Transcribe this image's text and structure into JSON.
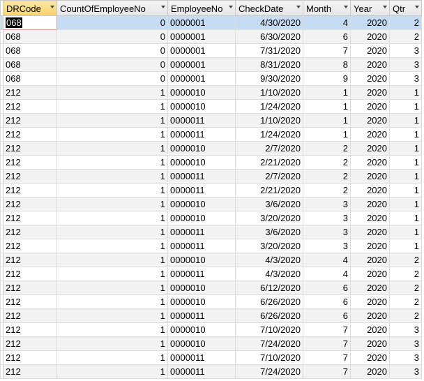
{
  "columns": [
    {
      "label": "DRCode",
      "align": "left"
    },
    {
      "label": "CountOfEmployeeNo",
      "align": "right"
    },
    {
      "label": "EmployeeNo",
      "align": "left"
    },
    {
      "label": "CheckDate",
      "align": "right"
    },
    {
      "label": "Month",
      "align": "right"
    },
    {
      "label": "Year",
      "align": "right"
    },
    {
      "label": "Qtr",
      "align": "right"
    }
  ],
  "rows": [
    [
      "068",
      "0",
      "0000001",
      "4/30/2020",
      "4",
      "2020",
      "2"
    ],
    [
      "068",
      "0",
      "0000001",
      "6/30/2020",
      "6",
      "2020",
      "2"
    ],
    [
      "068",
      "0",
      "0000001",
      "7/31/2020",
      "7",
      "2020",
      "3"
    ],
    [
      "068",
      "0",
      "0000001",
      "8/31/2020",
      "8",
      "2020",
      "3"
    ],
    [
      "068",
      "0",
      "0000001",
      "9/30/2020",
      "9",
      "2020",
      "3"
    ],
    [
      "212",
      "1",
      "0000010",
      "1/10/2020",
      "1",
      "2020",
      "1"
    ],
    [
      "212",
      "1",
      "0000010",
      "1/24/2020",
      "1",
      "2020",
      "1"
    ],
    [
      "212",
      "1",
      "0000011",
      "1/10/2020",
      "1",
      "2020",
      "1"
    ],
    [
      "212",
      "1",
      "0000011",
      "1/24/2020",
      "1",
      "2020",
      "1"
    ],
    [
      "212",
      "1",
      "0000010",
      "2/7/2020",
      "2",
      "2020",
      "1"
    ],
    [
      "212",
      "1",
      "0000010",
      "2/21/2020",
      "2",
      "2020",
      "1"
    ],
    [
      "212",
      "1",
      "0000011",
      "2/7/2020",
      "2",
      "2020",
      "1"
    ],
    [
      "212",
      "1",
      "0000011",
      "2/21/2020",
      "2",
      "2020",
      "1"
    ],
    [
      "212",
      "1",
      "0000010",
      "3/6/2020",
      "3",
      "2020",
      "1"
    ],
    [
      "212",
      "1",
      "0000010",
      "3/20/2020",
      "3",
      "2020",
      "1"
    ],
    [
      "212",
      "1",
      "0000011",
      "3/6/2020",
      "3",
      "2020",
      "1"
    ],
    [
      "212",
      "1",
      "0000011",
      "3/20/2020",
      "3",
      "2020",
      "1"
    ],
    [
      "212",
      "1",
      "0000010",
      "4/3/2020",
      "4",
      "2020",
      "2"
    ],
    [
      "212",
      "1",
      "0000011",
      "4/3/2020",
      "4",
      "2020",
      "2"
    ],
    [
      "212",
      "1",
      "0000010",
      "6/12/2020",
      "6",
      "2020",
      "2"
    ],
    [
      "212",
      "1",
      "0000010",
      "6/26/2020",
      "6",
      "2020",
      "2"
    ],
    [
      "212",
      "1",
      "0000011",
      "6/26/2020",
      "6",
      "2020",
      "2"
    ],
    [
      "212",
      "1",
      "0000010",
      "7/10/2020",
      "7",
      "2020",
      "3"
    ],
    [
      "212",
      "1",
      "0000010",
      "7/24/2020",
      "7",
      "2020",
      "3"
    ],
    [
      "212",
      "1",
      "0000011",
      "7/10/2020",
      "7",
      "2020",
      "3"
    ],
    [
      "212",
      "1",
      "0000011",
      "7/24/2020",
      "7",
      "2020",
      "3"
    ]
  ],
  "selected_column_index": 0,
  "current_row_index": 0,
  "colors": {
    "selected_header": "#f6d46a",
    "current_row": "#c5dcf3",
    "alt_row": "#f2f2f2"
  },
  "icons": {
    "header_dropdown": "chevron-down-icon"
  }
}
